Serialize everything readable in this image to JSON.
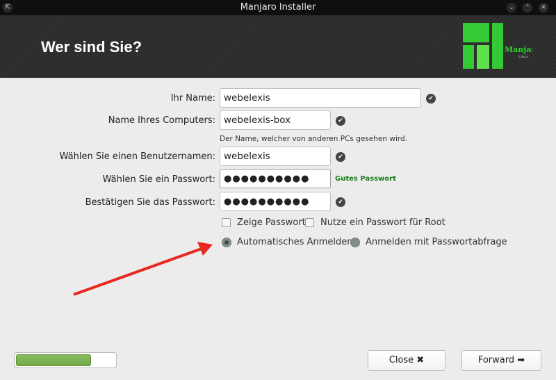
{
  "window": {
    "title": "Manjaro Installer"
  },
  "header": {
    "title": "Wer sind Sie?",
    "logo_text": "Manjaro",
    "logo_sub": "Linux"
  },
  "form": {
    "name_label": "Ihr Name:",
    "name_value": "webelexis",
    "computer_label": "Name Ihres Computers:",
    "computer_value": "webelexis-box",
    "computer_hint": "Der Name, welcher von anderen PCs gesehen wird.",
    "user_label": "Wählen Sie einen Benutzernamen:",
    "user_value": "webelexis",
    "password_label": "Wählen Sie ein Passwort:",
    "password_value": "●●●●●●●●●●",
    "password_strength": "Gutes Passwort",
    "password_strength_color": "#1a7a1a",
    "confirm_label": "Bestätigen Sie das Passwort:",
    "confirm_value": "●●●●●●●●●●",
    "show_password": "Zeige Passwort",
    "root_password": "Nutze ein Passwort für Root",
    "auto_login": "Automatisches Anmelden",
    "password_login": "Anmelden mit Passwortabfrage"
  },
  "footer": {
    "progress_percent": 76,
    "close_label": "Close ✖",
    "forward_label": "Forward ➡"
  },
  "annotation": {
    "arrow_color": "#e8281f"
  }
}
